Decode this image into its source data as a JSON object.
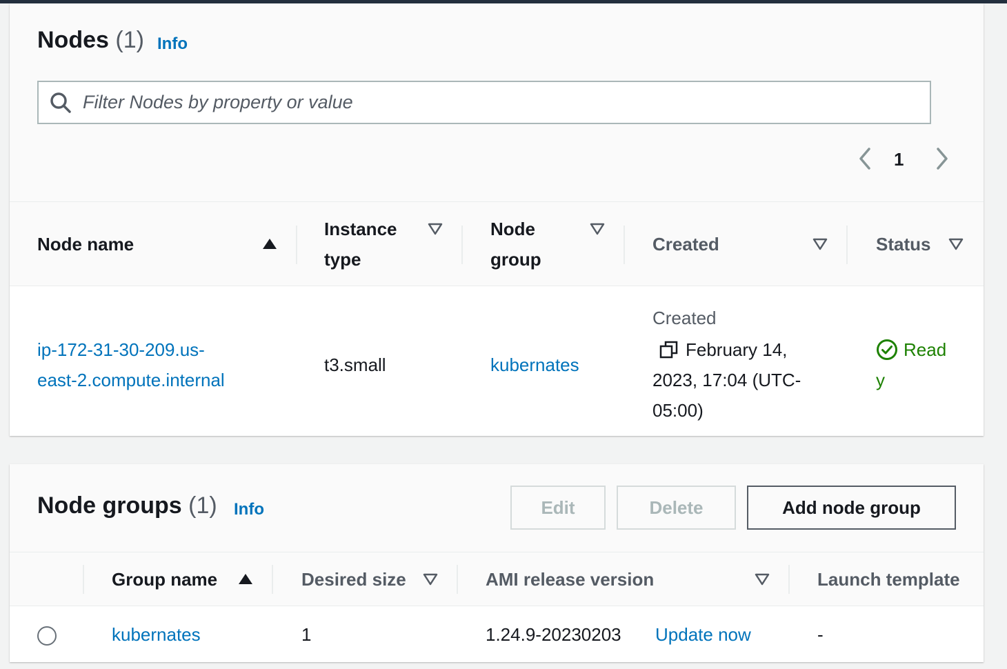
{
  "nodes": {
    "title": "Nodes",
    "count": "(1)",
    "info": "Info",
    "filter_placeholder": "Filter Nodes by property or value",
    "page": "1",
    "columns": {
      "node_name": "Node name",
      "instance_type_1": "Instance",
      "instance_type_2": "type",
      "node_group_1": "Node",
      "node_group_2": "group",
      "created": "Created",
      "status": "Status"
    },
    "rows": [
      {
        "node_name_1": "ip-172-31-30-209.us-",
        "node_name_2": "east-2.compute.internal",
        "instance_type": "t3.small",
        "node_group": "kubernates",
        "created_label": "Created",
        "created_1": "February 14,",
        "created_2": "2023, 17:04 (UTC-",
        "created_3": "05:00)",
        "status_1": "Read",
        "status_2": "y"
      }
    ]
  },
  "node_groups": {
    "title": "Node groups",
    "count": "(1)",
    "info": "Info",
    "buttons": {
      "edit": "Edit",
      "delete": "Delete",
      "add": "Add node group"
    },
    "columns": {
      "group_name": "Group name",
      "desired_size": "Desired size",
      "ami_release": "AMI release version",
      "launch_template": "Launch template"
    },
    "rows": [
      {
        "group_name": "kubernates",
        "desired_size": "1",
        "ami_release": "1.24.9-20230203",
        "update_link": "Update now",
        "launch_template": "-"
      }
    ]
  },
  "colors": {
    "link": "#0073bb",
    "success": "#1d8102",
    "text": "#16191f",
    "muted": "#545b64",
    "border": "#aab7b8"
  },
  "icons": [
    "search-icon",
    "chevron-left-icon",
    "chevron-right-icon",
    "sort-ascending-icon",
    "sort-icon",
    "copy-icon",
    "status-success-icon"
  ]
}
